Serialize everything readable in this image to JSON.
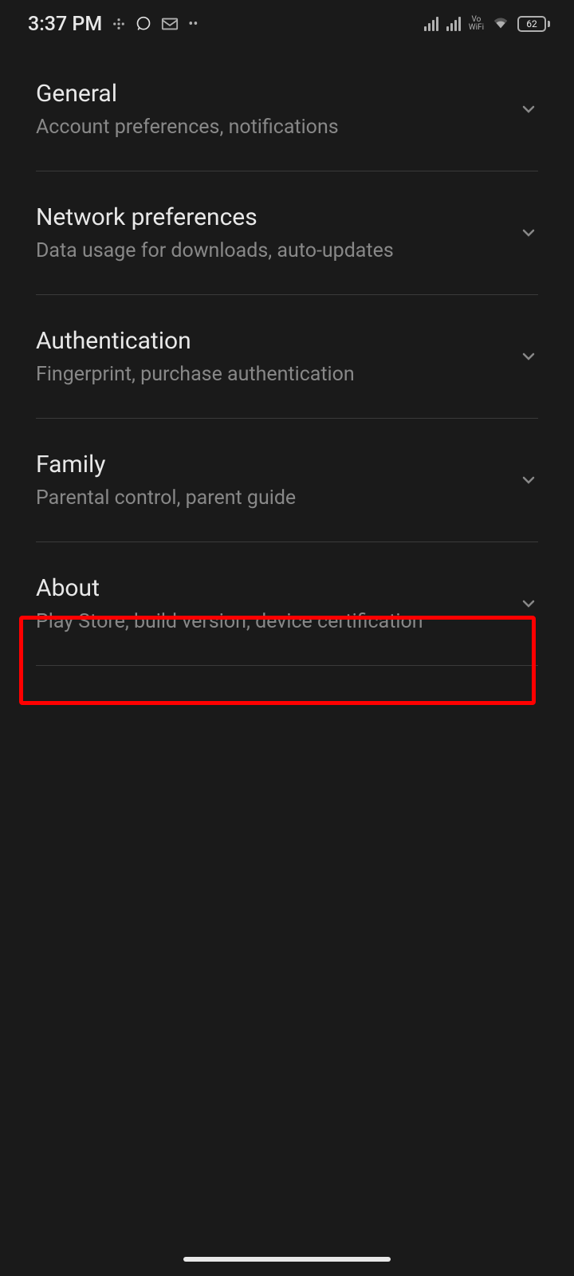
{
  "status_bar": {
    "time": "3:37 PM",
    "vowifi_top": "Vo",
    "vowifi_bottom": "WiFi",
    "battery_level": "62"
  },
  "settings": {
    "items": [
      {
        "title": "General",
        "subtitle": "Account preferences, notifications"
      },
      {
        "title": "Network preferences",
        "subtitle": "Data usage for downloads, auto-updates"
      },
      {
        "title": "Authentication",
        "subtitle": "Fingerprint, purchase authentication"
      },
      {
        "title": "Family",
        "subtitle": "Parental control, parent guide"
      },
      {
        "title": "About",
        "subtitle": "Play Store, build version, device certification"
      }
    ]
  }
}
